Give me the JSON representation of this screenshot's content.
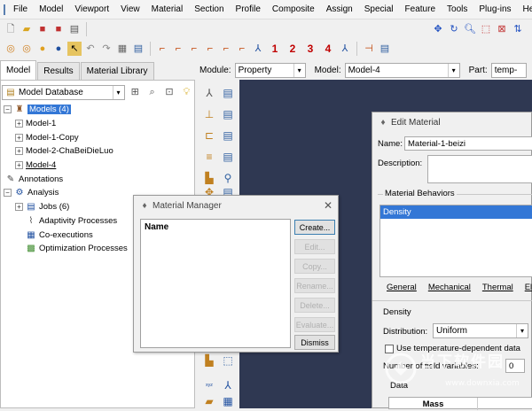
{
  "menu": [
    "File",
    "Model",
    "Viewport",
    "View",
    "Material",
    "Section",
    "Profile",
    "Composite",
    "Assign",
    "Special",
    "Feature",
    "Tools",
    "Plug-ins",
    "Help"
  ],
  "toolbar2_numbers": [
    "1",
    "2",
    "3",
    "4"
  ],
  "left_tabs": [
    "Model",
    "Results",
    "Material Library"
  ],
  "module": {
    "module_label": "Module:",
    "module_value": "Property",
    "model_label": "Model:",
    "model_value": "Model-4",
    "part_label": "Part:",
    "part_value": "temp-"
  },
  "database_combo": "Model Database",
  "tree": {
    "models": "Models (4)",
    "model1": "Model-1",
    "model1copy": "Model-1-Copy",
    "model2": "Model-2-ChaBeiDieLuo",
    "model4": "Model-4",
    "annotations": "Annotations",
    "analysis": "Analysis",
    "jobs": "Jobs (6)",
    "adaptivity": "Adaptivity Processes",
    "coexec": "Co-executions",
    "optimization": "Optimization Processes"
  },
  "material_manager": {
    "title": "Material Manager",
    "list_header": "Name",
    "buttons": [
      "Create...",
      "Edit...",
      "Copy...",
      "Rename...",
      "Delete...",
      "Evaluate...",
      "Dismiss"
    ]
  },
  "edit_material": {
    "title": "Edit Material",
    "name_label": "Name:",
    "name_value": "Material-1-beizi",
    "description_label": "Description:",
    "behaviors_label": "Material Behaviors",
    "behavior_selected": "Density",
    "tabs": [
      "General",
      "Mechanical",
      "Thermal",
      "Ele"
    ],
    "density_section": "Density",
    "distribution_label": "Distribution:",
    "distribution_value": "Uniform",
    "temp_dependent_label": "Use temperature-dependent data",
    "field_vars_label": "Number of field variables:",
    "field_vars_value": "0",
    "data_label": "Data",
    "table_header": "Mass"
  },
  "watermark": {
    "text_cn": "当下软件园",
    "text_url": "www.downxia.com"
  },
  "colors": {
    "viewport": "#2f3852",
    "selection": "#3377d6"
  }
}
